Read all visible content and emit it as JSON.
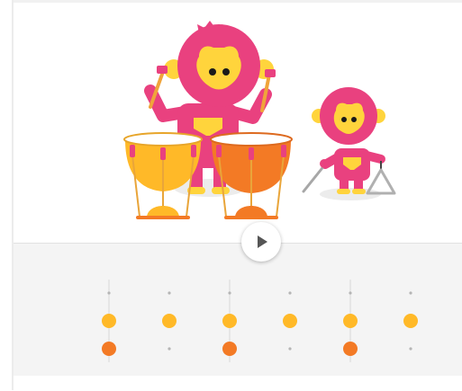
{
  "colors": {
    "monkey_pink": "#e9417f",
    "monkey_face": "#ffd43c",
    "drum_yellow": "#ffb928",
    "drum_orange": "#f37a25",
    "panel_bg": "#f4f4f4",
    "beat_line": "#d9d9d9",
    "rest_dot": "#b5b5b5",
    "play_icon": "#555555"
  },
  "characters": [
    {
      "name": "big-monkey",
      "instrument": "timpani-drums"
    },
    {
      "name": "small-monkey",
      "instrument": "triangle"
    }
  ],
  "controls": {
    "play_icon": "play-icon"
  },
  "sequencer": {
    "columns": 6,
    "rows": [
      "yellow-drum",
      "orange-drum"
    ],
    "accent_columns": [
      true,
      false,
      true,
      false,
      true,
      false
    ],
    "yellow_row": [
      true,
      true,
      true,
      true,
      true,
      true
    ],
    "orange_row": [
      true,
      false,
      true,
      false,
      true,
      false
    ]
  }
}
